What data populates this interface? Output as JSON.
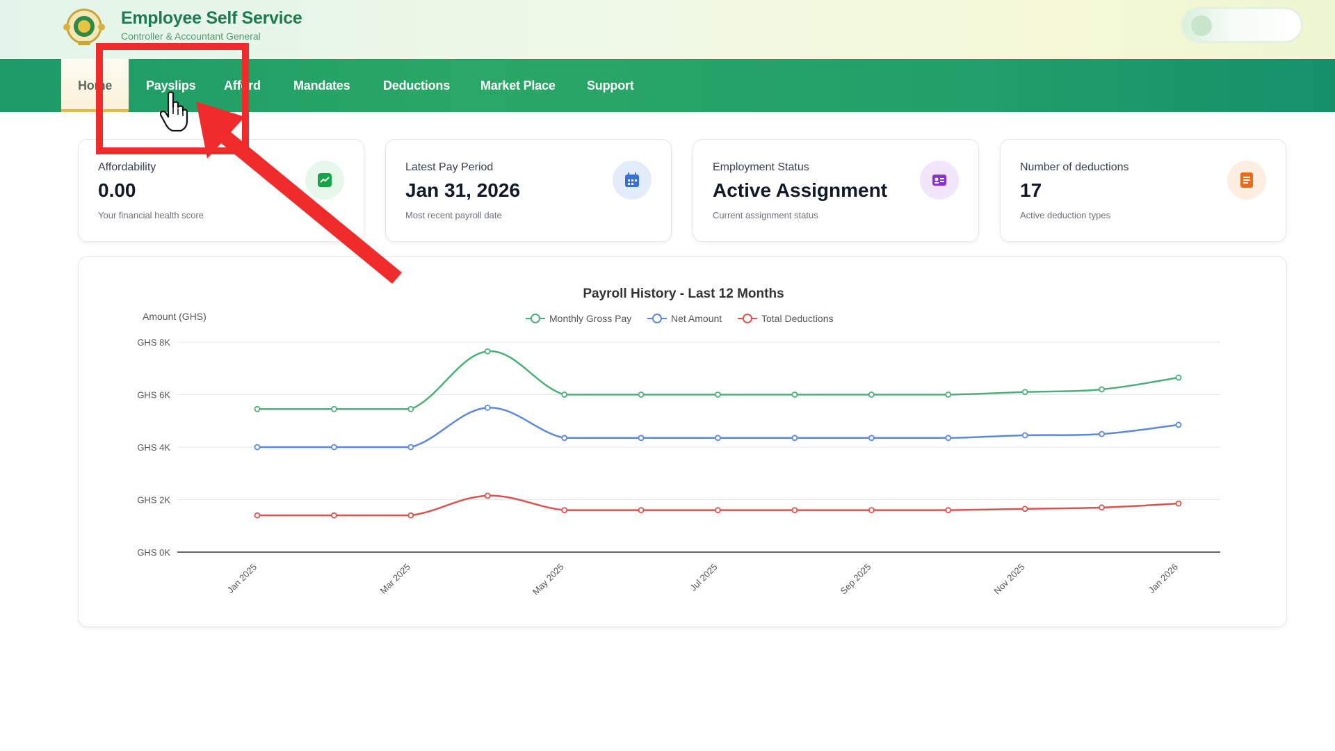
{
  "header": {
    "title": "Employee Self Service",
    "subtitle": "Controller & Accountant General"
  },
  "nav": {
    "items": [
      {
        "label": "Home",
        "active": true
      },
      {
        "label": "Payslips",
        "active": false
      },
      {
        "label": "Afford",
        "active": false
      },
      {
        "label": "Mandates",
        "active": false
      },
      {
        "label": "Deductions",
        "active": false
      },
      {
        "label": "Market Place",
        "active": false
      },
      {
        "label": "Support",
        "active": false
      }
    ]
  },
  "cards": [
    {
      "label": "Affordability",
      "value": "0.00",
      "description": "Your financial health score",
      "icon": "trend-up-icon",
      "color": "#16a34a",
      "bg": "#e8f7ec"
    },
    {
      "label": "Latest Pay Period",
      "value": "Jan 31, 2026",
      "description": "Most recent payroll date",
      "icon": "calendar-icon",
      "color": "#3b6fd8",
      "bg": "#e3ecfb"
    },
    {
      "label": "Employment Status",
      "value": "Active Assignment",
      "description": "Current assignment status",
      "icon": "id-card-icon",
      "color": "#8b2fd6",
      "bg": "#f1e6fb"
    },
    {
      "label": "Number of deductions",
      "value": "17",
      "description": "Active deduction types",
      "icon": "document-icon",
      "color": "#ea6a1c",
      "bg": "#fdeee1"
    }
  ],
  "chart_data": {
    "type": "line",
    "title": "Payroll History - Last 12 Months",
    "ylabel": "Amount (GHS)",
    "xlabel": "",
    "ylim": [
      0,
      8000
    ],
    "yticks": [
      "GHS 0K",
      "GHS 2K",
      "GHS 4K",
      "GHS 6K",
      "GHS 8K"
    ],
    "ytick_values": [
      0,
      2000,
      4000,
      6000,
      8000
    ],
    "x": [
      "Jan 2025",
      "Feb 2025",
      "Mar 2025",
      "Apr 2025",
      "May 2025",
      "Jun 2025",
      "Jul 2025",
      "Aug 2025",
      "Sep 2025",
      "Oct 2025",
      "Nov 2025",
      "Dec 2025",
      "Jan 2026"
    ],
    "xtick_labels": [
      "Jan 2025",
      "Mar 2025",
      "May 2025",
      "Jul 2025",
      "Sep 2025",
      "Nov 2025",
      "Jan 2026"
    ],
    "grid": true,
    "legend_position": "top",
    "series": [
      {
        "name": "Monthly Gross Pay",
        "color": "#4caf7a",
        "values": [
          5450,
          5450,
          5450,
          7650,
          6000,
          6000,
          6000,
          6000,
          6000,
          6000,
          6100,
          6200,
          6650
        ]
      },
      {
        "name": "Net Amount",
        "color": "#5b87dd",
        "values": [
          4000,
          4000,
          4000,
          5500,
          4350,
          4350,
          4350,
          4350,
          4350,
          4350,
          4450,
          4500,
          4850
        ]
      },
      {
        "name": "Total Deductions",
        "color": "#d9534f",
        "values": [
          1400,
          1400,
          1400,
          2150,
          1600,
          1600,
          1600,
          1600,
          1600,
          1600,
          1650,
          1700,
          1850
        ]
      }
    ]
  }
}
